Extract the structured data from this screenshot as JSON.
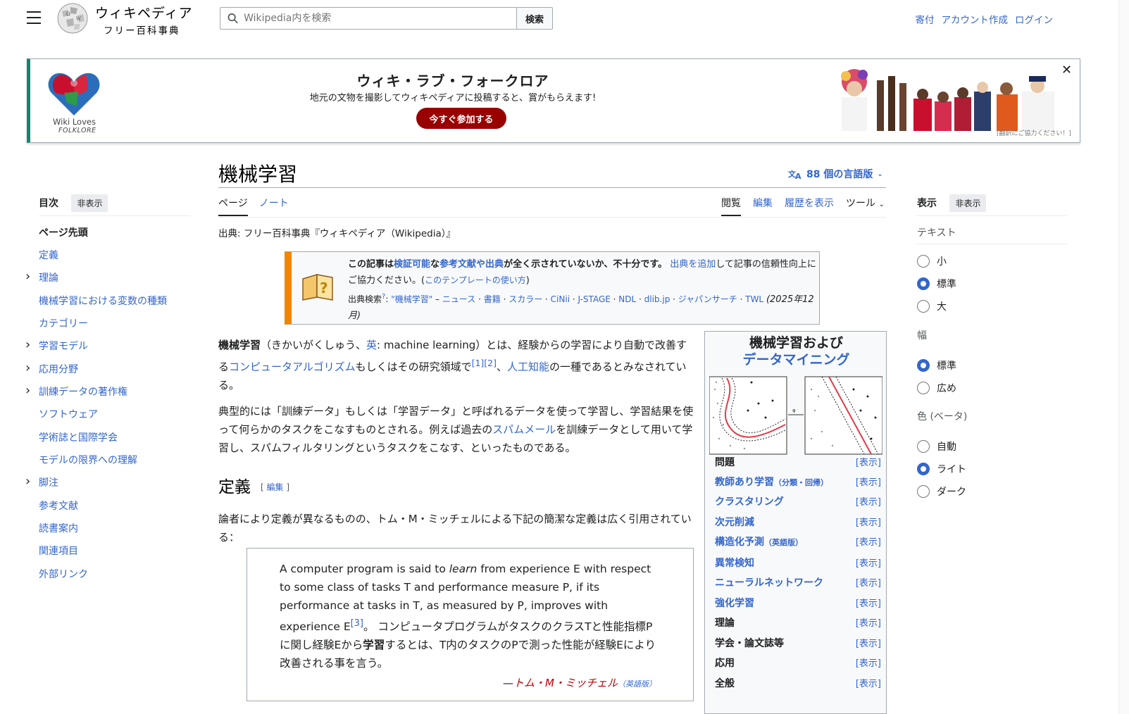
{
  "header": {
    "wordmark_line1": "ウィキペディア",
    "wordmark_line2": "フリー百科事典",
    "search_placeholder": "Wikipedia内を検索",
    "search_button": "検索",
    "links": [
      "寄付",
      "アカウント作成",
      "ログイン"
    ]
  },
  "banner": {
    "logo_line1": "Wiki Loves",
    "logo_line2": "FOLKLORE",
    "title": "ウィキ・ラブ・フォークロア",
    "subtitle": "地元の文物を撮影してウィキペディアに投稿すると、賞がもらえます!",
    "button": "今すぐ参加する",
    "credit": "[翻訳にご協力ください！]"
  },
  "toc": {
    "title": "目次",
    "hide": "非表示",
    "items": [
      {
        "label": "ページ先頭",
        "expandable": false
      },
      {
        "label": "定義",
        "expandable": false
      },
      {
        "label": "理論",
        "expandable": true
      },
      {
        "label": "機械学習における変数の種類",
        "expandable": false
      },
      {
        "label": "カテゴリー",
        "expandable": false
      },
      {
        "label": "学習モデル",
        "expandable": true
      },
      {
        "label": "応用分野",
        "expandable": true
      },
      {
        "label": "訓練データの著作権",
        "expandable": true
      },
      {
        "label": "ソフトウェア",
        "expandable": false
      },
      {
        "label": "学術誌と国際学会",
        "expandable": false
      },
      {
        "label": "モデルの限界への理解",
        "expandable": false
      },
      {
        "label": "脚注",
        "expandable": true
      },
      {
        "label": "参考文献",
        "expandable": false
      },
      {
        "label": "読書案内",
        "expandable": false
      },
      {
        "label": "関連項目",
        "expandable": false
      },
      {
        "label": "外部リンク",
        "expandable": false
      }
    ]
  },
  "article": {
    "title": "機械学習",
    "languages": "88 個の言語版",
    "tabs_left": [
      "ページ",
      "ノート"
    ],
    "tabs_right": [
      "閲覧",
      "編集",
      "履歴を表示",
      "ツール"
    ],
    "from": "出典: フリー百科事典『ウィキペディア（Wikipedia）』",
    "ambox": {
      "p1_a": "この記事は",
      "p1_b": "検証可能",
      "p1_c": "な",
      "p1_d": "参考文献や出典",
      "p1_e": "が全く示されていないか、不十分です。",
      "p1_f": "出典を追加",
      "p1_g": "して記事の信頼性向上にご協力ください。(",
      "p1_h": "このテンプレートの使い方",
      "p1_i": ")",
      "search_label": "出典検索",
      "search_sup": "?",
      "search_term": "\"機械学習\"",
      "search_dash": " – ",
      "search_links": [
        "ニュース",
        "書籍",
        "スカラー",
        "CiNii",
        "J-STAGE",
        "NDL",
        "dlib.jp",
        "ジャパンサーチ",
        "TWL"
      ],
      "date": "(2025年12月)"
    },
    "p1": {
      "bold": "機械学習",
      "t1": "（きかいがくしゅう、",
      "en": "英",
      "t2": ": machine learning）とは、経験からの学習により自動で改善する",
      "link1": "コンピュータアルゴリズム",
      "t3": "もしくはその研究領域で",
      "ref": "[1][2]",
      "t4": "、",
      "link2": "人工知能",
      "t5": "の一種であるとみなされている。"
    },
    "p2": {
      "t1": "典型的には「訓練データ」もしくは「学習データ」と呼ばれるデータを使って学習し、学習結果を使って何らかのタスクをこなすものとされる。例えば過去の",
      "link": "スパムメール",
      "t2": "を訓練データとして用いて学習し、スパムフィルタリングというタスクをこなす、といったものである。"
    },
    "section_title": "定義",
    "section_edit": "編集",
    "p3": "論者により定義が異なるものの、トム・M・ミッチェルによる下記の簡潔な定義は広く引用されている：",
    "quote": {
      "en1": "A computer program is said to ",
      "en_learn": "learn",
      "en2": " from experience E with respect to some class of tasks T and performance measure P, if its performance at tasks in T, as measured by P, improves with experience E",
      "ref": "[3]",
      "ja1": "。 コンピュータプログラムがタスクのクラスTと性能指標Pに関し経験Eから",
      "ja_bold": "学習",
      "ja2": "するとは、T内のタスクのPで測った性能が経験Eにより改善される事を言う。",
      "author_dash": "—",
      "author": "トム・M・ミッチェル",
      "author_note": "（英語版）"
    }
  },
  "infobox": {
    "title1": "機械学習および",
    "title2": "データマイニング",
    "show": "[表示]",
    "rows": [
      {
        "label": "問題",
        "link": false,
        "note": ""
      },
      {
        "label": "教師あり学習",
        "link": true,
        "note": "（分類・回帰）"
      },
      {
        "label": "クラスタリング",
        "link": true,
        "note": ""
      },
      {
        "label": "次元削減",
        "link": true,
        "note": ""
      },
      {
        "label": "構造化予測",
        "link": true,
        "note": "（英語版）"
      },
      {
        "label": "異常検知",
        "link": true,
        "note": ""
      },
      {
        "label": "ニューラルネットワーク",
        "link": true,
        "note": ""
      },
      {
        "label": "強化学習",
        "link": true,
        "note": ""
      },
      {
        "label": "理論",
        "link": false,
        "note": ""
      },
      {
        "label": "学会・論文誌等",
        "link": false,
        "note": ""
      },
      {
        "label": "応用",
        "link": false,
        "note": ""
      },
      {
        "label": "全般",
        "link": false,
        "note": ""
      }
    ]
  },
  "panel": {
    "title": "表示",
    "hide": "非表示",
    "text_label": "テキスト",
    "text_options": [
      "小",
      "標準",
      "大"
    ],
    "width_label": "幅",
    "width_options": [
      "標準",
      "広め"
    ],
    "color_label": "色 (ベータ)",
    "color_options": [
      "自動",
      "ライト",
      "ダーク"
    ]
  },
  "colors": {
    "link": "#3366cc",
    "banner_accent": "#14866d",
    "banner_button": "#990000",
    "ambox_accent": "#f28500"
  }
}
